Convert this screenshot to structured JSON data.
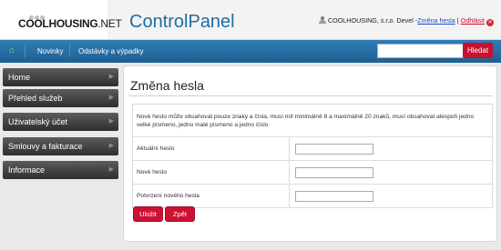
{
  "header": {
    "logo_bold": "COOL",
    "logo_bold2": "HOUSING",
    "logo_suffix": ".NET",
    "app_title": "ControlPanel",
    "user_text": "COOLHOUSING, s.r.o. Devel -",
    "change_password_link": "Změna hesla",
    "separator": " | ",
    "logout_link": "Odhlásit",
    "logout_glyph": "✕"
  },
  "nav": {
    "home_glyph": "⌂",
    "items": [
      "Novinky",
      "Odstávky a výpadky"
    ],
    "search_placeholder": "",
    "search_button": "Hledat"
  },
  "sidebar": {
    "items": [
      {
        "label": "Home"
      },
      {
        "label": "Přehled služeb"
      },
      {
        "label": "Uživatelský účet"
      },
      {
        "label": "Smlouvy a fakturace"
      },
      {
        "label": "Informace"
      }
    ],
    "chevron": "▶"
  },
  "form": {
    "title": "Změna hesla",
    "note": "Nové heslo může obsahovat pouze znaky a čísla, musí mít minimálně 8 a maximálně 20 znaků, musí obsahovat alespoň jedno velké písmeno, jedno malé písmeno a jedno číslo",
    "fields": [
      {
        "label": "Aktuální heslo",
        "value": ""
      },
      {
        "label": "Nové heslo",
        "value": ""
      },
      {
        "label": "Potvrzení nového hesla",
        "value": ""
      }
    ],
    "save_button": "Uložit",
    "back_button": "Zpět"
  },
  "colors": {
    "accent_blue": "#1f6ca3",
    "nav_blue": "#2f7db5",
    "brand_red": "#c8102e"
  }
}
